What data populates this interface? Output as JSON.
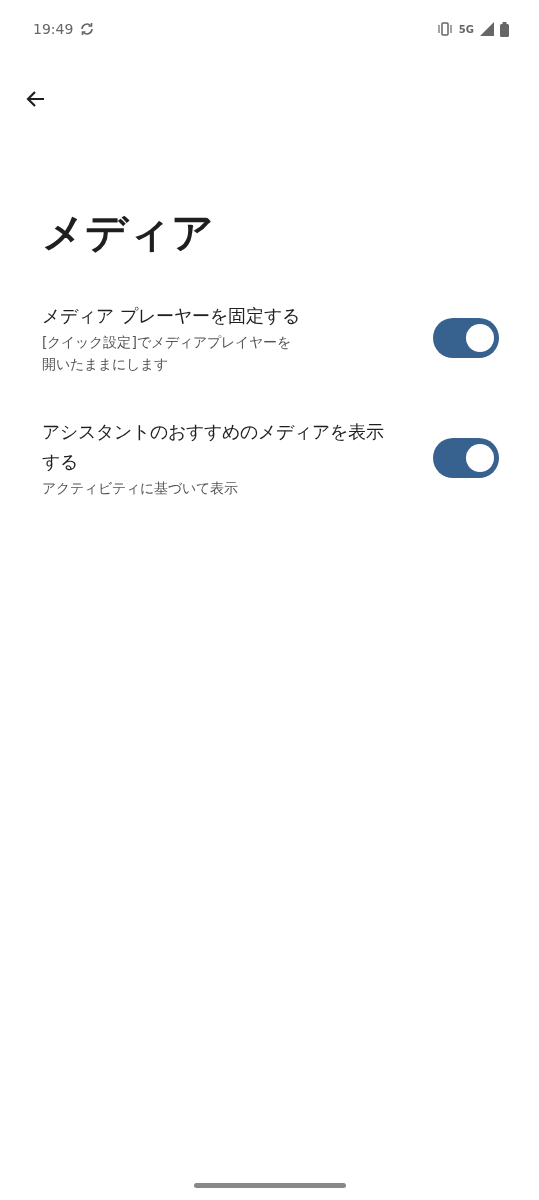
{
  "status_bar": {
    "time": "19:49",
    "network": "5G"
  },
  "title": "メディア",
  "settings": [
    {
      "title": "メディア プレーヤーを固定する",
      "summary": "[クイック設定]でメディアプレイヤーを開いたままにします",
      "on": true
    },
    {
      "title": "アシスタントのおすすめのメディアを表示する",
      "summary": "アクティビティに基づいて表示",
      "on": true
    }
  ]
}
